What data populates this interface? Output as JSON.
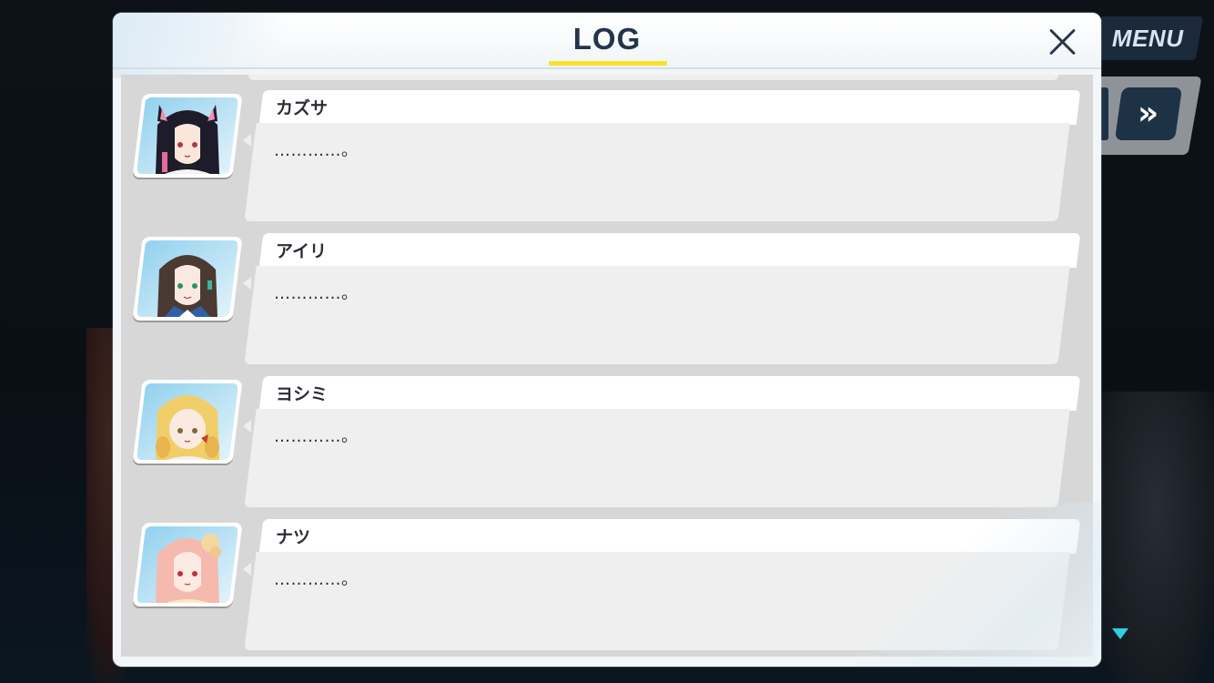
{
  "panel": {
    "title": "LOG",
    "close_icon": "close-icon"
  },
  "controls": {
    "menu_label": "MENU",
    "fast_forward_glyph": "»",
    "fast_forward_icon": "fast-forward-icon",
    "scroll_indicator_icon": "chevron-down-icon"
  },
  "colors": {
    "title_underline": "#f5e22a",
    "scroll_indicator": "#2dd1e6"
  },
  "entries": [
    {
      "speaker": "カズサ",
      "text": "…………。",
      "avatar": "kazusa-portrait"
    },
    {
      "speaker": "アイリ",
      "text": "…………。",
      "avatar": "airi-portrait"
    },
    {
      "speaker": "ヨシミ",
      "text": "…………。",
      "avatar": "yoshimi-portrait"
    },
    {
      "speaker": "ナツ",
      "text": "…………。",
      "avatar": "natsu-portrait"
    }
  ]
}
